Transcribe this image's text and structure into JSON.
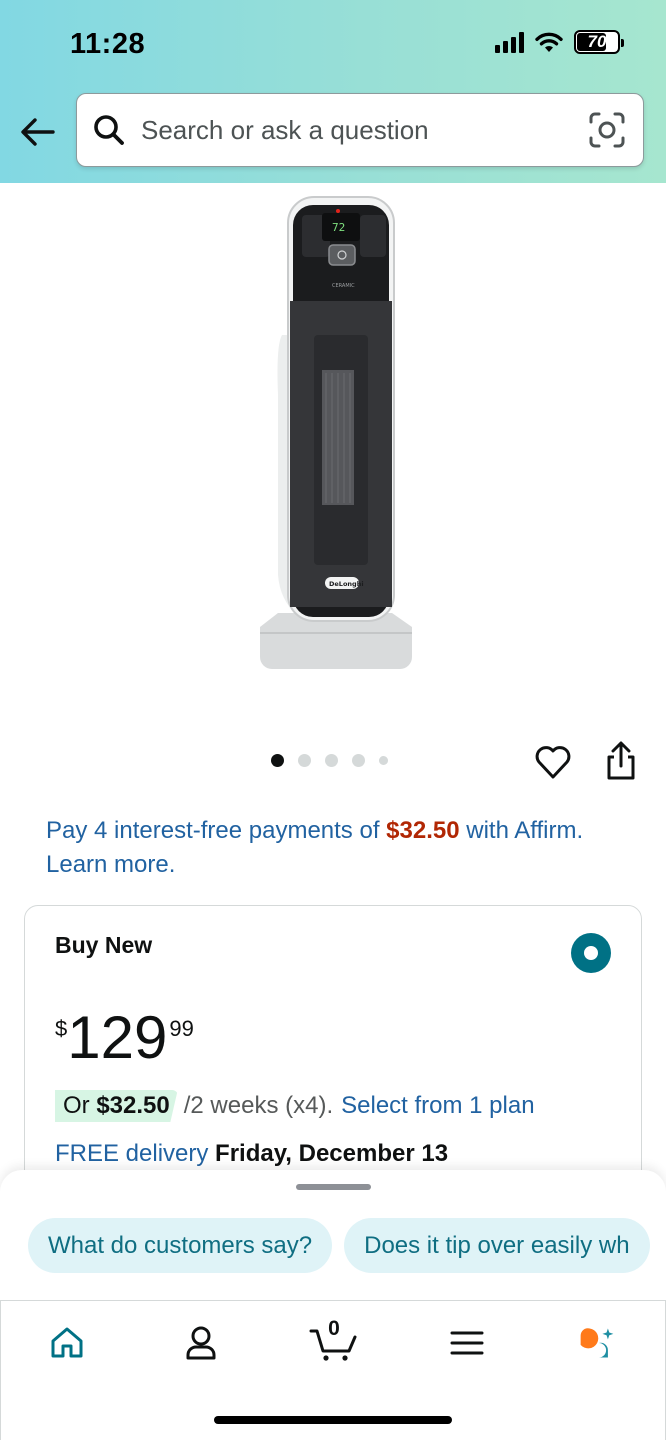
{
  "status_bar": {
    "time": "11:28",
    "battery": "70"
  },
  "search": {
    "placeholder": "Search or ask a question"
  },
  "product": {
    "image_alt": "De'Longhi ceramic tower heater",
    "brand_mark": "DeLonghi",
    "display_temp": "72",
    "carousel": {
      "total": 5,
      "active": 1
    }
  },
  "affirm": {
    "prefix": "Pay 4 interest-free payments of ",
    "amount": "$32.50",
    "suffix": " with Affirm. Learn more."
  },
  "buy_box": {
    "title": "Buy New",
    "selected": true,
    "price_symbol": "$",
    "price_whole": "129",
    "price_fraction": "99",
    "installment_prefix": "Or ",
    "installment_amount": "$32.50",
    "installment_period": "/2 weeks (x4).",
    "installment_link": "Select from 1 plan",
    "delivery_label": "FREE delivery",
    "delivery_date": "Friday, December 13"
  },
  "questions": [
    "What do customers say?",
    "Does it tip over easily wh"
  ],
  "bottom_nav": {
    "items": [
      "home-icon",
      "account-icon",
      "cart-icon",
      "menu-icon",
      "rufus-icon"
    ],
    "cart_count": "0",
    "accent": "#007185",
    "rufus_colors": [
      "#ff7a1a",
      "#1f8fa3"
    ]
  }
}
